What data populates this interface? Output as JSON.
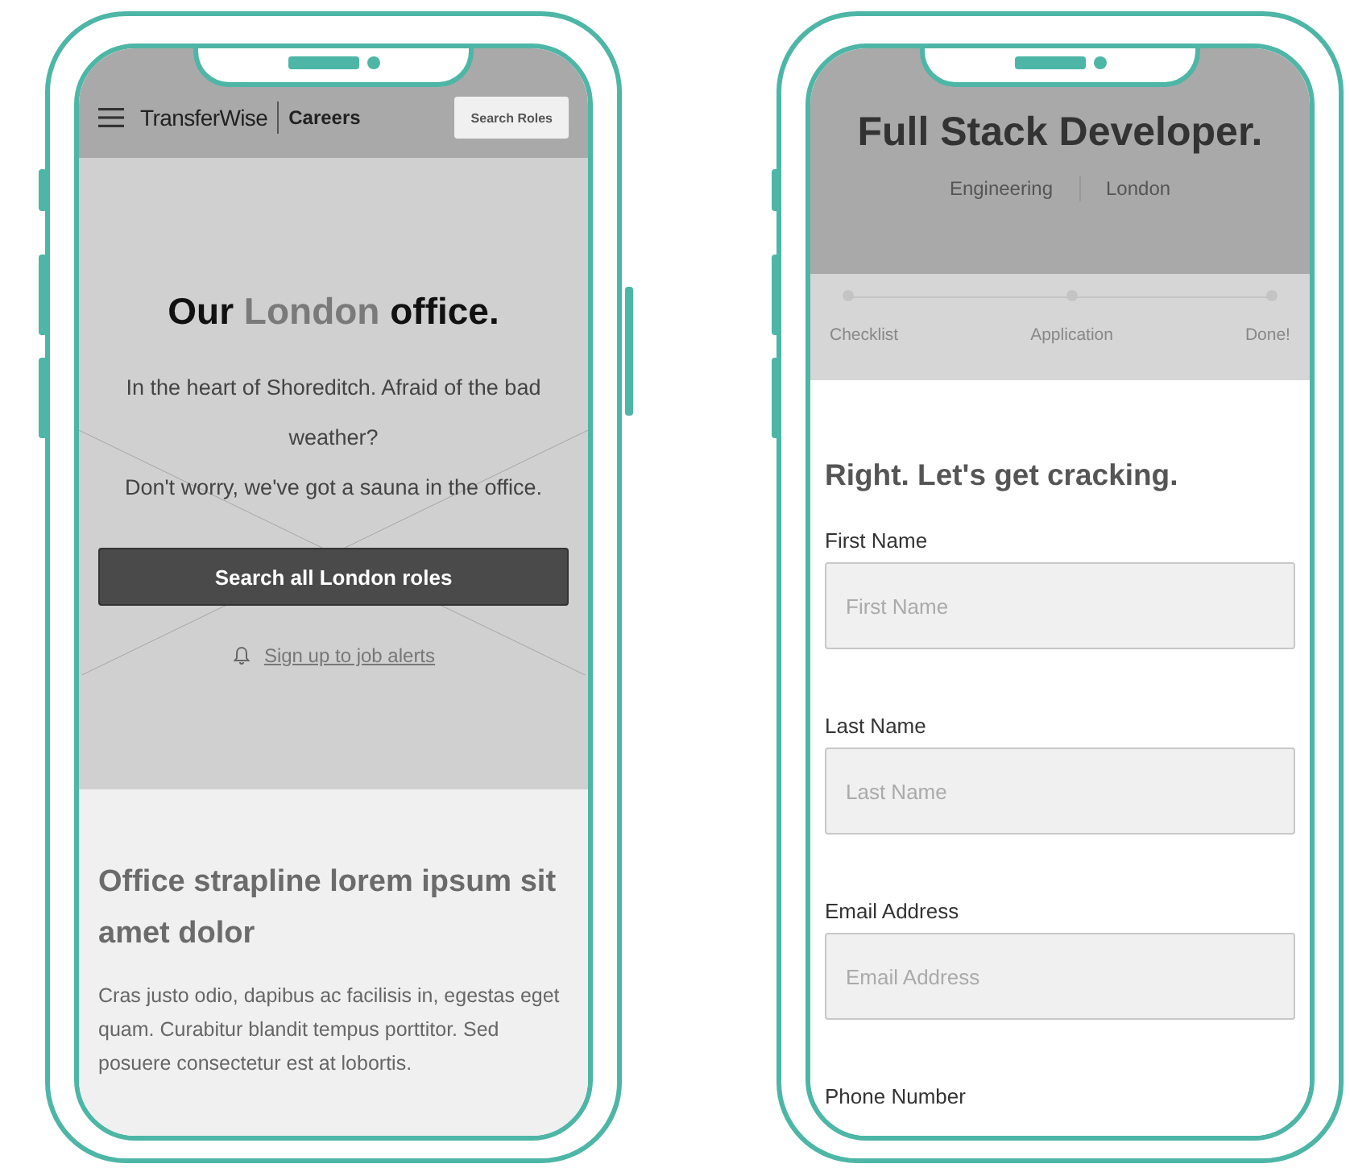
{
  "office_page": {
    "nav": {
      "brand": "TransferWise",
      "section": "Careers",
      "button": "Search Roles"
    },
    "hero": {
      "title": [
        {
          "text": "Our ",
          "muted": false
        },
        {
          "text": "London",
          "muted": true
        },
        {
          "text": " office.",
          "muted": false
        }
      ],
      "lines": [
        "In the heart of Shoreditch. Afraid of the bad weather?",
        "Don't worry, we've got a sauna in the office."
      ],
      "button": "Search all London roles",
      "link": "Sign up to job alerts"
    },
    "strapline": {
      "heading": "Office strapline lorem ipsum sit amet dolor",
      "body": "Cras justo odio, dapibus ac facilisis in, egestas eget quam. Curabitur blandit tempus porttitor. Sed posuere consectetur est at lobortis."
    }
  },
  "application_page": {
    "title": "Full Stack Developer.",
    "meta": [
      "Engineering",
      "London"
    ],
    "steps": [
      {
        "label": "Checklist"
      },
      {
        "label": "Application"
      },
      {
        "label": "Done!"
      }
    ],
    "heading": "Right. Let's get cracking.",
    "fields": [
      {
        "kind": "input",
        "label": "First Name",
        "placeholder": "First Name"
      },
      {
        "kind": "input",
        "label": "Last Name",
        "placeholder": "Last Name"
      },
      {
        "kind": "input",
        "label": "Email Address",
        "placeholder": "Email Address"
      },
      {
        "kind": "label",
        "label": "Phone Number"
      }
    ]
  }
}
